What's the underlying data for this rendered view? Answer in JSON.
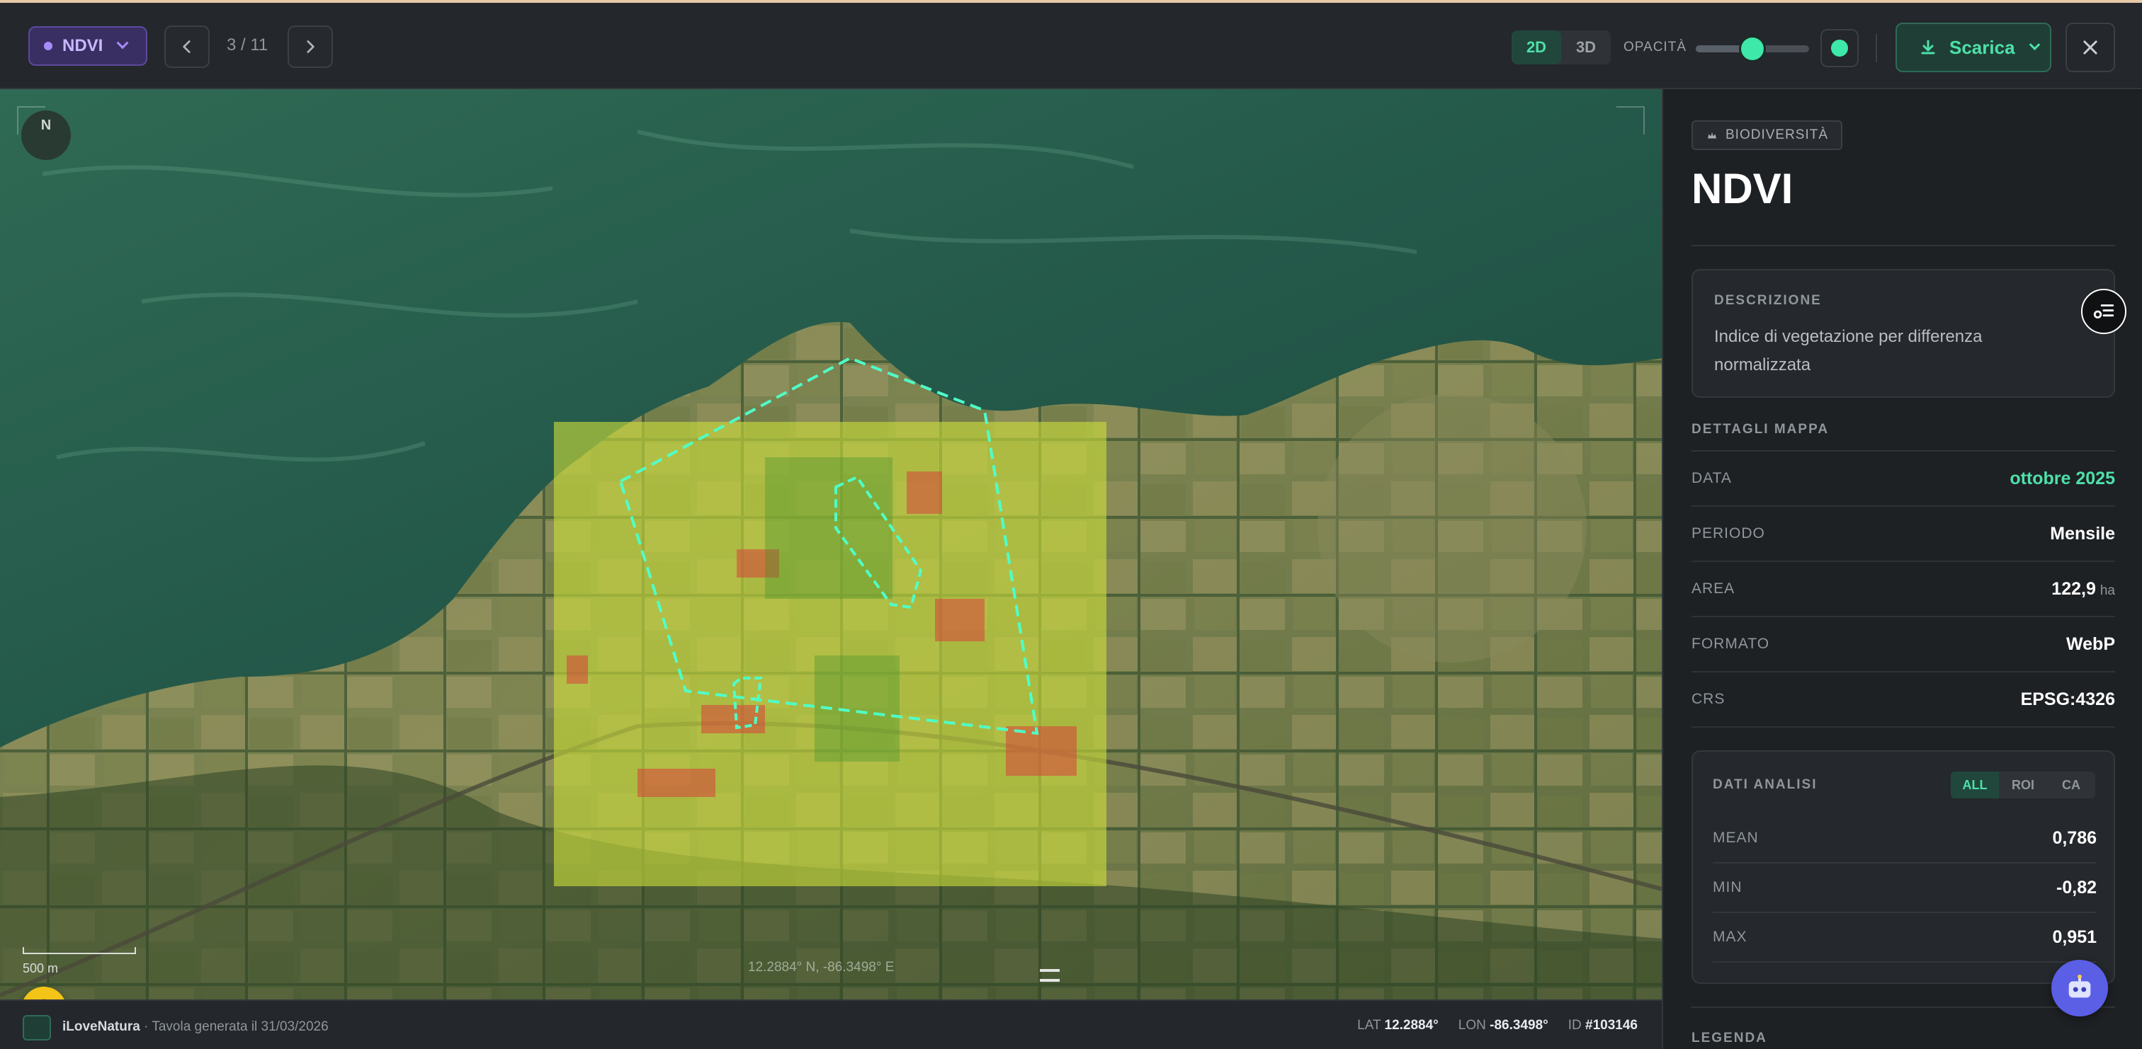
{
  "toolbar": {
    "layer_label": "NDVI",
    "pager": "3 / 11",
    "view_2d": "2D",
    "view_3d": "3D",
    "opacity_label": "OPACITÀ",
    "opacity_value": 0.5,
    "accent": "#3ee8a8",
    "download_label": "Scarica"
  },
  "map": {
    "north_label": "N",
    "scale_label": "500 m",
    "coordinate_readout": "12.2884° N, -86.3498° E"
  },
  "footer": {
    "brand": "iLoveNatura",
    "generated": " · Tavola generata il 31/03/2026",
    "lat_label": "LAT",
    "lat_value": "12.2884°",
    "lon_label": "LON",
    "lon_value": "-86.3498°",
    "id_label": "ID",
    "id_value": "#103146"
  },
  "panel": {
    "category": "BIODIVERSITÀ",
    "title": "NDVI",
    "description_label": "DESCRIZIONE",
    "description": "Indice di vegetazione per differenza normalizzata",
    "details_label": "DETTAGLI MAPPA",
    "details": [
      {
        "key": "DATA",
        "value": "ottobre 2025"
      },
      {
        "key": "PERIODO",
        "value": "Mensile"
      },
      {
        "key": "AREA",
        "value": "122,9",
        "unit": "ha"
      },
      {
        "key": "FORMATO",
        "value": "WebP"
      },
      {
        "key": "CRS",
        "value": "EPSG:4326"
      }
    ],
    "analysis_label": "DATI ANALISI",
    "analysis_tabs": [
      "ALL",
      "ROI",
      "CA"
    ],
    "analysis": [
      {
        "key": "MEAN",
        "value": "0,786"
      },
      {
        "key": "MIN",
        "value": "-0,82"
      },
      {
        "key": "MAX",
        "value": "0,951"
      }
    ],
    "legend_label": "LEGENDA"
  }
}
